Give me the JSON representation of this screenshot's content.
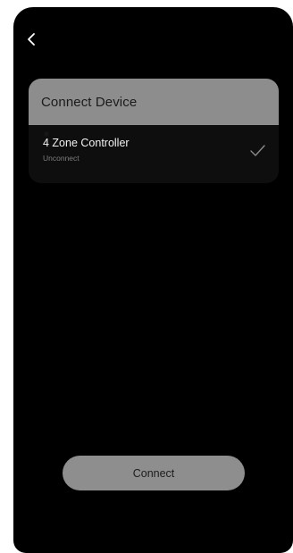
{
  "nav": {
    "back_icon": "chevron-left-icon"
  },
  "card": {
    "title": "Connect Device",
    "device": {
      "name": "4 Zone Controller",
      "status": "Unconnect",
      "selected_icon": "checkmark-icon"
    }
  },
  "actions": {
    "connect_label": "Connect"
  },
  "colors": {
    "background": "#000000",
    "card_header": "#8d8d8d",
    "button": "#8e8e8e",
    "text_primary": "#f2f2f2",
    "text_secondary": "#7d7d7d"
  }
}
